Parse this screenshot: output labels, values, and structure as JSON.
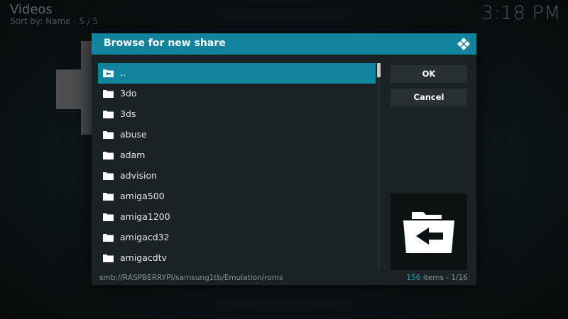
{
  "background": {
    "title": "Videos",
    "sort_label": "Sort by: Name",
    "sort_sep": "·",
    "sort_position": "5 / 5",
    "clock": "3:18 PM"
  },
  "dialog": {
    "title": "Browse for new share",
    "items": [
      {
        "label": "..",
        "icon": "folder-up-icon"
      },
      {
        "label": "3do",
        "icon": "folder-icon"
      },
      {
        "label": "3ds",
        "icon": "folder-icon"
      },
      {
        "label": "abuse",
        "icon": "folder-icon"
      },
      {
        "label": "adam",
        "icon": "folder-icon"
      },
      {
        "label": "advision",
        "icon": "folder-icon"
      },
      {
        "label": "amiga500",
        "icon": "folder-icon"
      },
      {
        "label": "amiga1200",
        "icon": "folder-icon"
      },
      {
        "label": "amigacd32",
        "icon": "folder-icon"
      },
      {
        "label": "amigacdtv",
        "icon": "folder-icon"
      }
    ],
    "ok_label": "OK",
    "cancel_label": "Cancel",
    "path": "smb://RASPBERRYPI/samsung1tb/Emulation/roms",
    "item_count": "156",
    "items_word": "items",
    "page_sep": "-",
    "page": "1/16"
  },
  "colors": {
    "accent": "#12839d",
    "count_accent": "#2fa4c2",
    "dialog_bg": "#1a2225",
    "button_bg": "#283033"
  }
}
